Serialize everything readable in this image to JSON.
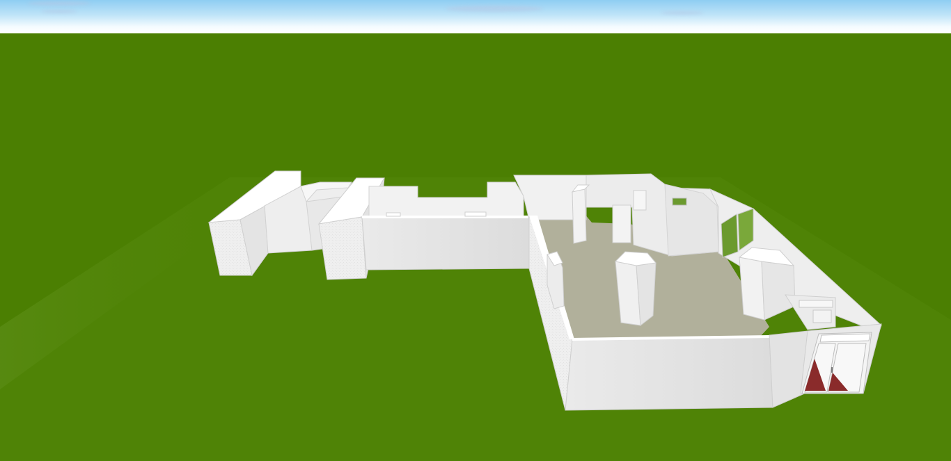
{
  "view": {
    "type": "3d-viewport",
    "description_label": "",
    "colors": {
      "sky_top": "#8fcdf2",
      "horizon": "#ffffff",
      "ground": "#4b7f02",
      "ground_light": "#5a8c14",
      "wall": "#ededed",
      "wall_shade": "#d6d6d6",
      "wall_top": "#ffffff",
      "floor": "#b1b09b",
      "window_glass": "#6b9a2e",
      "door_red": "#8a2b2b"
    },
    "icons": {
      "sky": "sky-background",
      "ground": "grass-ground-plane",
      "model": "house-model-3d"
    }
  }
}
